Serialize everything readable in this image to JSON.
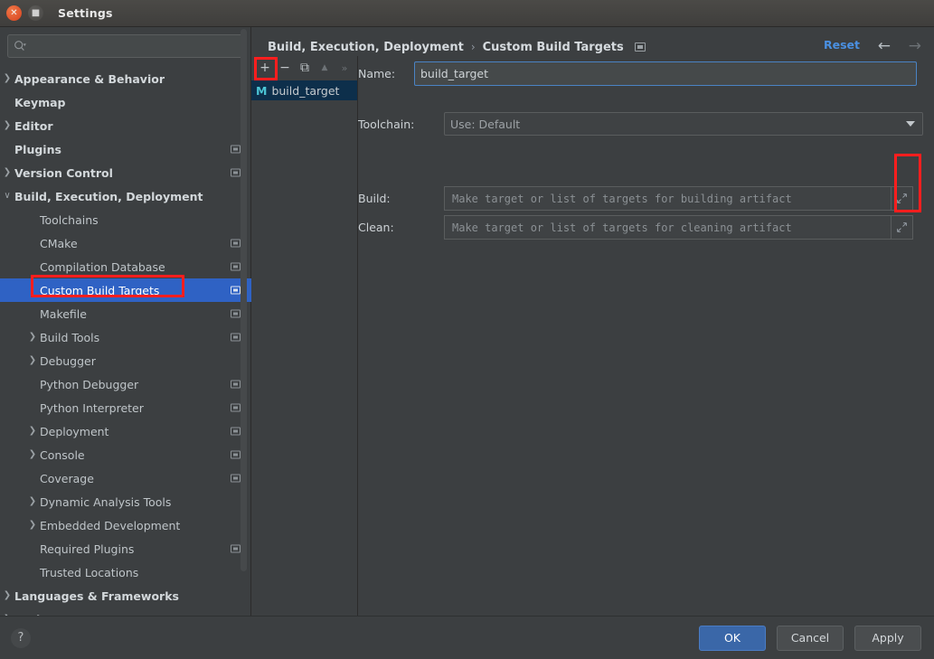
{
  "window": {
    "title": "Settings",
    "close_icon": "close-icon",
    "maximize_icon": "maximize-icon"
  },
  "search": {
    "placeholder": "",
    "value": "",
    "icon": "search-icon"
  },
  "sidebar": {
    "items": [
      {
        "label": "Appearance & Behavior",
        "level": 0,
        "arrow": "collapsed",
        "mark": false,
        "selected": false
      },
      {
        "label": "Keymap",
        "level": 0,
        "arrow": "none",
        "mark": false,
        "selected": false
      },
      {
        "label": "Editor",
        "level": 0,
        "arrow": "collapsed",
        "mark": false,
        "selected": false
      },
      {
        "label": "Plugins",
        "level": 0,
        "arrow": "none",
        "mark": true,
        "selected": false
      },
      {
        "label": "Version Control",
        "level": 0,
        "arrow": "collapsed",
        "mark": true,
        "selected": false
      },
      {
        "label": "Build, Execution, Deployment",
        "level": 0,
        "arrow": "expanded",
        "mark": false,
        "selected": false
      },
      {
        "label": "Toolchains",
        "level": 1,
        "arrow": "none",
        "mark": false,
        "selected": false
      },
      {
        "label": "CMake",
        "level": 1,
        "arrow": "none",
        "mark": true,
        "selected": false
      },
      {
        "label": "Compilation Database",
        "level": 1,
        "arrow": "none",
        "mark": true,
        "selected": false
      },
      {
        "label": "Custom Build Targets",
        "level": 1,
        "arrow": "none",
        "mark": true,
        "selected": true
      },
      {
        "label": "Makefile",
        "level": 1,
        "arrow": "none",
        "mark": true,
        "selected": false
      },
      {
        "label": "Build Tools",
        "level": 1,
        "arrow": "collapsed",
        "mark": true,
        "selected": false
      },
      {
        "label": "Debugger",
        "level": 1,
        "arrow": "collapsed",
        "mark": false,
        "selected": false
      },
      {
        "label": "Python Debugger",
        "level": 1,
        "arrow": "none",
        "mark": true,
        "selected": false
      },
      {
        "label": "Python Interpreter",
        "level": 1,
        "arrow": "none",
        "mark": true,
        "selected": false
      },
      {
        "label": "Deployment",
        "level": 1,
        "arrow": "collapsed",
        "mark": true,
        "selected": false
      },
      {
        "label": "Console",
        "level": 1,
        "arrow": "collapsed",
        "mark": true,
        "selected": false
      },
      {
        "label": "Coverage",
        "level": 1,
        "arrow": "none",
        "mark": true,
        "selected": false
      },
      {
        "label": "Dynamic Analysis Tools",
        "level": 1,
        "arrow": "collapsed",
        "mark": false,
        "selected": false
      },
      {
        "label": "Embedded Development",
        "level": 1,
        "arrow": "collapsed",
        "mark": false,
        "selected": false
      },
      {
        "label": "Required Plugins",
        "level": 1,
        "arrow": "none",
        "mark": true,
        "selected": false
      },
      {
        "label": "Trusted Locations",
        "level": 1,
        "arrow": "none",
        "mark": false,
        "selected": false
      },
      {
        "label": "Languages & Frameworks",
        "level": 0,
        "arrow": "collapsed",
        "mark": false,
        "selected": false
      },
      {
        "label": "Tools",
        "level": 0,
        "arrow": "collapsed",
        "mark": false,
        "selected": false
      }
    ]
  },
  "header": {
    "breadcrumb_root": "Build, Execution, Deployment",
    "breadcrumb_separator": "›",
    "breadcrumb_current": "Custom Build Targets",
    "project_scope_icon": "project-setting-icon",
    "reset_label": "Reset",
    "back_icon": "arrow-left-icon",
    "forward_icon": "arrow-right-icon"
  },
  "targets": {
    "toolbar": [
      {
        "name": "add-target-button",
        "glyph": "+",
        "disabled": false
      },
      {
        "name": "remove-target-button",
        "glyph": "−",
        "disabled": false
      },
      {
        "name": "copy-target-button",
        "glyph": "⧉",
        "disabled": false
      },
      {
        "name": "move-up-button",
        "glyph": "▲",
        "disabled": true
      },
      {
        "name": "more-options-button",
        "glyph": "»",
        "disabled": true
      }
    ],
    "items": [
      {
        "badge": "M",
        "label": "build_target",
        "selected": true
      }
    ]
  },
  "form": {
    "name_label": "Name:",
    "name_value": "build_target",
    "toolchain_label": "Toolchain:",
    "toolchain_value": "Use: Default",
    "build_label": "Build:",
    "build_placeholder": "Make target or list of targets for building artifact",
    "build_value": "",
    "clean_label": "Clean:",
    "clean_placeholder": "Make target or list of targets for cleaning artifact",
    "clean_value": "",
    "expand_icon": "expand-arrows-icon"
  },
  "footer": {
    "help_label": "?",
    "ok_label": "OK",
    "cancel_label": "Cancel",
    "apply_label": "Apply"
  },
  "colors": {
    "window_bg": "#3c3f41",
    "selection_blue": "#2f62c4",
    "accent_link": "#4a90e2",
    "primary_button": "#3a67a8",
    "annotation_red": "#ff1e1e",
    "badge_cyan": "#4cc6d6",
    "list_selection": "#0d2f4b"
  }
}
